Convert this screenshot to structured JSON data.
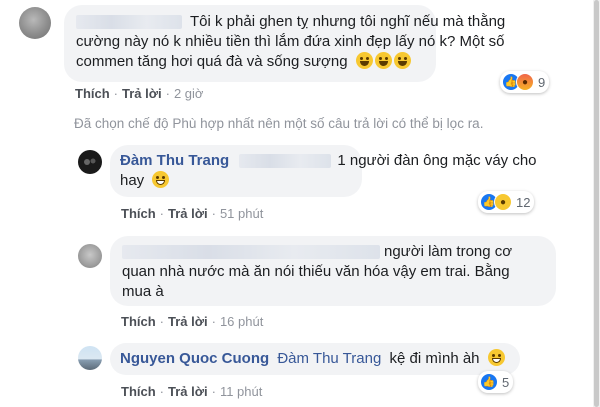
{
  "comments": [
    {
      "author": "",
      "text": "Tôi k phải ghen tỵ nhưng tôi nghĩ nếu mà thằng cường này nó k nhiều tiền thì lắm đứa xinh đẹp lấy nó k? Một số commen tăng hơi quá đà và sống sượng",
      "line1": "Tôi k phải ghen tỵ nhưng tôi nghĩ nếu mà thằng",
      "line2": "cường này nó k nhiều tiền thì lắm đứa xinh đẹp lấy nó k? Một số",
      "line3": "commen tăng hơi quá đà và sống sượng",
      "emojis": [
        "grimace-emoji",
        "grimace-emoji",
        "grimace-emoji"
      ],
      "actions": {
        "like": "Thích",
        "reply": "Trả lời",
        "time": "2 giờ"
      },
      "reactions": {
        "icons": [
          "like-icon",
          "angry-icon"
        ],
        "count": "9"
      }
    }
  ],
  "filter_note": "Đã chọn chế độ Phù hợp nhất nên một số câu trả lời có thể bị lọc ra.",
  "replies": [
    {
      "author": "Đàm Thu Trang",
      "line1": "1 người đàn ông mặc váy cho",
      "line2": "hay",
      "emoji": "smile-emoji",
      "actions": {
        "like": "Thích",
        "reply": "Trả lời",
        "time": "51 phút"
      },
      "reactions": {
        "icons": [
          "like-icon",
          "haha-icon"
        ],
        "count": "12"
      }
    },
    {
      "author": "",
      "line1": "người làm trong cơ",
      "line2": "quan nhà nước mà ăn nói thiếu văn hóa vậy em trai. Bằng",
      "line3": "mua à",
      "actions": {
        "like": "Thích",
        "reply": "Trả lời",
        "time": "16 phút"
      }
    },
    {
      "author": "Nguyen Quoc Cuong",
      "mention": "Đàm Thu Trang",
      "text": "kệ đi mình àh",
      "emoji": "smile-emoji",
      "actions": {
        "like": "Thích",
        "reply": "Trả lời",
        "time": "11 phút"
      },
      "reactions": {
        "icons": [
          "like-icon"
        ],
        "count": "5"
      }
    }
  ]
}
